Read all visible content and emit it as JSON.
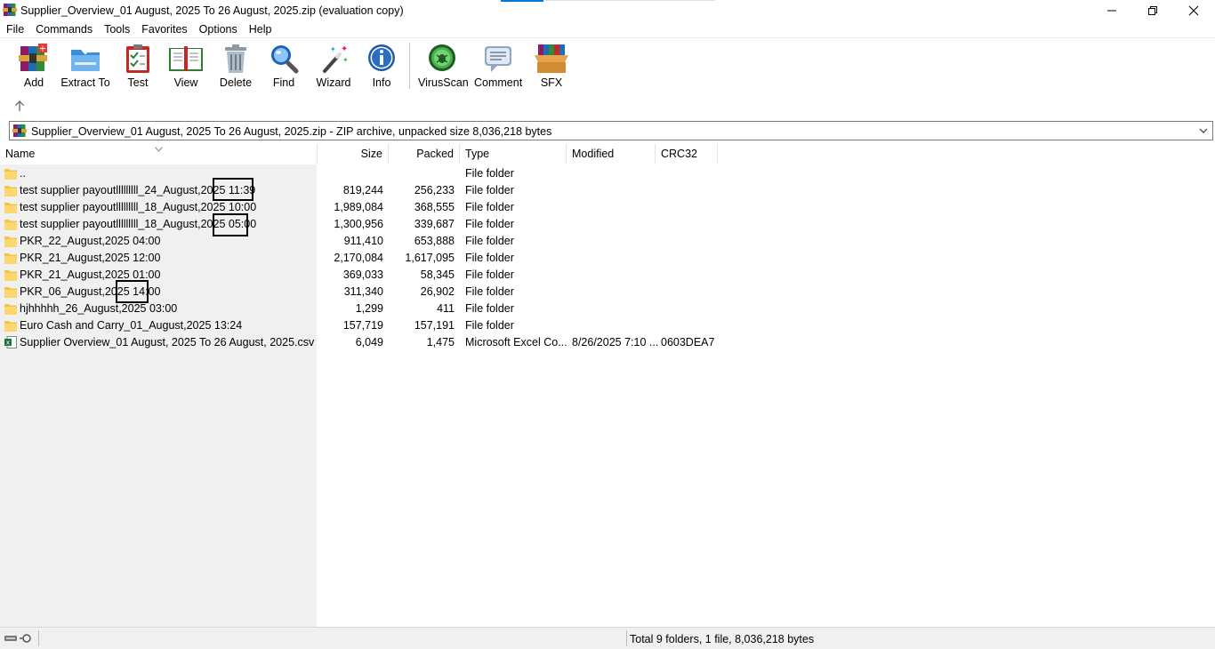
{
  "window": {
    "title": "Supplier_Overview_01 August, 2025 To 26 August, 2025.zip (evaluation copy)",
    "controls": [
      "minimize",
      "maximize",
      "close"
    ]
  },
  "menu": [
    "File",
    "Commands",
    "Tools",
    "Favorites",
    "Options",
    "Help"
  ],
  "toolbar": [
    {
      "label": "Add",
      "icon": "add-archive-icon"
    },
    {
      "label": "Extract To",
      "icon": "extract-folder-icon"
    },
    {
      "label": "Test",
      "icon": "test-clipboard-icon"
    },
    {
      "label": "View",
      "icon": "view-book-icon"
    },
    {
      "label": "Delete",
      "icon": "trash-bin-icon"
    },
    {
      "label": "Find",
      "icon": "magnifier-icon"
    },
    {
      "label": "Wizard",
      "icon": "magic-wand-icon"
    },
    {
      "label": "Info",
      "icon": "info-icon"
    },
    {
      "label": "VirusScan",
      "icon": "virus-scan-icon"
    },
    {
      "label": "Comment",
      "icon": "comment-icon"
    },
    {
      "label": "SFX",
      "icon": "sfx-box-icon"
    }
  ],
  "address": "Supplier_Overview_01 August, 2025 To 26 August, 2025.zip - ZIP archive, unpacked size 8,036,218 bytes",
  "columns": {
    "name": "Name",
    "size": "Size",
    "packed": "Packed",
    "type": "Type",
    "modified": "Modified",
    "crc": "CRC32"
  },
  "rows": [
    {
      "name": "..",
      "size": "",
      "packed": "",
      "type": "File folder",
      "modified": "",
      "crc": "",
      "icon": "folder-icon"
    },
    {
      "name": "test supplier payoutlllllllll_24_August,2025 11:39",
      "size": "819,244",
      "packed": "256,233",
      "type": "File folder",
      "modified": "",
      "crc": "",
      "icon": "folder-icon"
    },
    {
      "name": "test supplier payoutlllllllll_18_August,2025 10:00",
      "size": "1,989,084",
      "packed": "368,555",
      "type": "File folder",
      "modified": "",
      "crc": "",
      "icon": "folder-icon"
    },
    {
      "name": "test supplier payoutlllllllll_18_August,2025 05:00",
      "size": "1,300,956",
      "packed": "339,687",
      "type": "File folder",
      "modified": "",
      "crc": "",
      "icon": "folder-icon"
    },
    {
      "name": "PKR_22_August,2025 04:00",
      "size": "911,410",
      "packed": "653,888",
      "type": "File folder",
      "modified": "",
      "crc": "",
      "icon": "folder-icon"
    },
    {
      "name": "PKR_21_August,2025 12:00",
      "size": "2,170,084",
      "packed": "1,617,095",
      "type": "File folder",
      "modified": "",
      "crc": "",
      "icon": "folder-icon"
    },
    {
      "name": "PKR_21_August,2025 01:00",
      "size": "369,033",
      "packed": "58,345",
      "type": "File folder",
      "modified": "",
      "crc": "",
      "icon": "folder-icon"
    },
    {
      "name": "PKR_06_August,2025 14:00",
      "size": "311,340",
      "packed": "26,902",
      "type": "File folder",
      "modified": "",
      "crc": "",
      "icon": "folder-icon"
    },
    {
      "name": "hjhhhhh_26_August,2025 03:00",
      "size": "1,299",
      "packed": "411",
      "type": "File folder",
      "modified": "",
      "crc": "",
      "icon": "folder-icon"
    },
    {
      "name": "Euro Cash and  Carry_01_August,2025 13:24",
      "size": "157,719",
      "packed": "157,191",
      "type": "File folder",
      "modified": "",
      "crc": "",
      "icon": "folder-icon"
    },
    {
      "name": "Supplier Overview_01 August, 2025 To 26 August, 2025.csv",
      "size": "6,049",
      "packed": "1,475",
      "type": "Microsoft Excel Co...",
      "modified": "8/26/2025 7:10 ...",
      "crc": "0603DEA7",
      "icon": "excel-file-icon"
    }
  ],
  "status": {
    "text": "Total 9 folders, 1 file, 8,036,218 bytes"
  },
  "colors": {
    "folder": "#f6c343",
    "accent": "#0078d7",
    "highlight_box": "#000000"
  }
}
